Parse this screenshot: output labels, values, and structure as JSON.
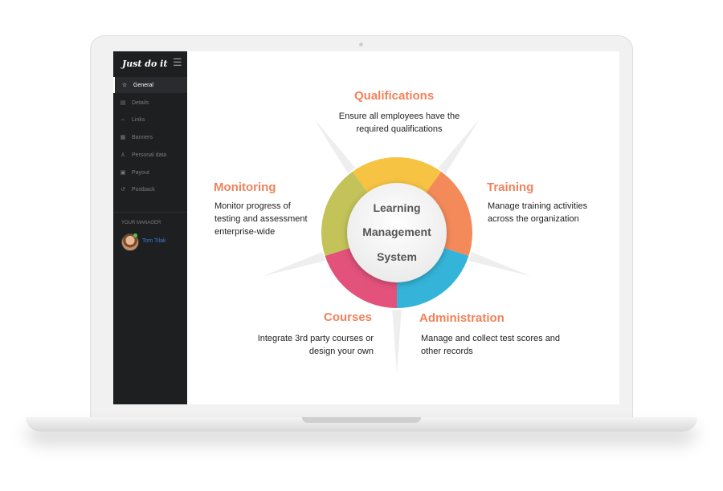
{
  "sidebar": {
    "logo": "Just do it",
    "menu_icon": "hamburger-icon",
    "items": [
      {
        "label": "General",
        "icon": "star-icon",
        "glyph": "☆",
        "active": true
      },
      {
        "label": "Details",
        "icon": "details-icon",
        "glyph": "▤",
        "active": false
      },
      {
        "label": "Links",
        "icon": "link-icon",
        "glyph": "⇔",
        "active": false
      },
      {
        "label": "Banners",
        "icon": "banners-icon",
        "glyph": "▦",
        "active": false
      },
      {
        "label": "Personal data",
        "icon": "person-icon",
        "glyph": "♙",
        "active": false
      },
      {
        "label": "Payout",
        "icon": "payout-icon",
        "glyph": "▣",
        "active": false
      },
      {
        "label": "Postback",
        "icon": "postback-icon",
        "glyph": "↺",
        "active": false
      }
    ],
    "manager": {
      "heading": "YOUR MANAGER",
      "name": "Tom Tilak"
    }
  },
  "diagram": {
    "center": [
      "Learning",
      "Management",
      "System"
    ],
    "segments": [
      {
        "title": "Qualifications",
        "desc": [
          "Ensure all employees have the",
          "required qualifications"
        ],
        "color": "#f6c342"
      },
      {
        "title": "Training",
        "desc": [
          "Manage training activities",
          "across the organization"
        ],
        "color": "#f48a5a"
      },
      {
        "title": "Administration",
        "desc": [
          "Manage and collect test scores and",
          "other records"
        ],
        "color": "#34b4d8"
      },
      {
        "title": "Courses",
        "desc": [
          "Integrate 3rd party courses or",
          "design your own"
        ],
        "color": "#e2527b"
      },
      {
        "title": "Monitoring",
        "desc": [
          "Monitor progress of",
          "testing and assessment",
          "enterprise-wide"
        ],
        "color": "#c3c35a"
      }
    ],
    "title_color": "#f0825a"
  }
}
